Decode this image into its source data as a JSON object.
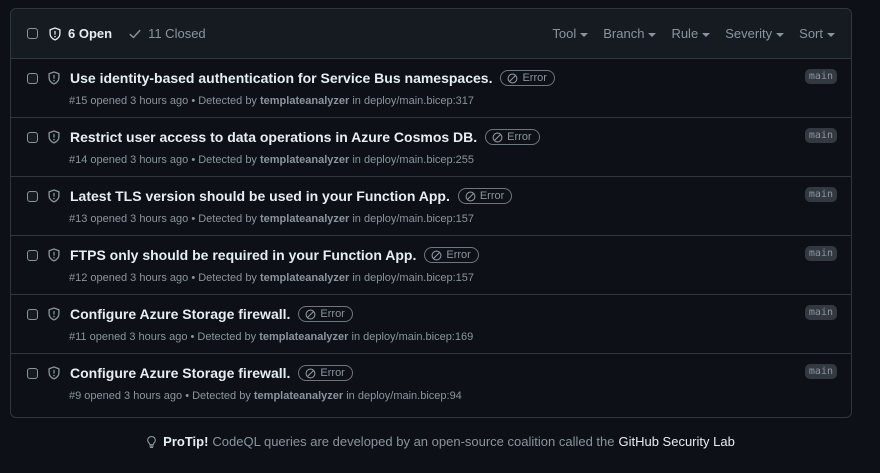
{
  "header": {
    "open_label": "6 Open",
    "closed_label": "11 Closed",
    "filters": [
      {
        "label": "Tool"
      },
      {
        "label": "Branch"
      },
      {
        "label": "Rule"
      },
      {
        "label": "Severity"
      },
      {
        "label": "Sort"
      }
    ]
  },
  "alerts": [
    {
      "title": "Use identity-based authentication for Service Bus namespaces.",
      "severity": "Error",
      "meta_prefix": "#15 opened 3 hours ago • Detected by",
      "author": "templateanalyzer",
      "in": "in",
      "location": "deploy/main.bicep:317",
      "branch": "main"
    },
    {
      "title": "Restrict user access to data operations in Azure Cosmos DB.",
      "severity": "Error",
      "meta_prefix": "#14 opened 3 hours ago • Detected by",
      "author": "templateanalyzer",
      "in": "in",
      "location": "deploy/main.bicep:255",
      "branch": "main"
    },
    {
      "title": "Latest TLS version should be used in your Function App.",
      "severity": "Error",
      "meta_prefix": "#13 opened 3 hours ago • Detected by",
      "author": "templateanalyzer",
      "in": "in",
      "location": "deploy/main.bicep:157",
      "branch": "main"
    },
    {
      "title": "FTPS only should be required in your Function App.",
      "severity": "Error",
      "meta_prefix": "#12 opened 3 hours ago • Detected by",
      "author": "templateanalyzer",
      "in": "in",
      "location": "deploy/main.bicep:157",
      "branch": "main"
    },
    {
      "title": "Configure Azure Storage firewall.",
      "severity": "Error",
      "meta_prefix": "#11 opened 3 hours ago • Detected by",
      "author": "templateanalyzer",
      "in": "in",
      "location": "deploy/main.bicep:169",
      "branch": "main"
    },
    {
      "title": "Configure Azure Storage firewall.",
      "severity": "Error",
      "meta_prefix": "#9 opened 3 hours ago • Detected by",
      "author": "templateanalyzer",
      "in": "in",
      "location": "deploy/main.bicep:94",
      "branch": "main"
    }
  ],
  "protip": {
    "label": "ProTip!",
    "text": "CodeQL queries are developed by an open-source coalition called the",
    "link": "GitHub Security Lab"
  },
  "colors": {
    "background": "#0d1117",
    "header_bg": "#161b22",
    "border": "#30363d",
    "text": "#e6edf3",
    "muted": "#8b949e"
  },
  "icons": [
    "checkbox",
    "shield-icon",
    "check-icon",
    "caret-down-icon",
    "stop-icon",
    "light-bulb-icon"
  ]
}
